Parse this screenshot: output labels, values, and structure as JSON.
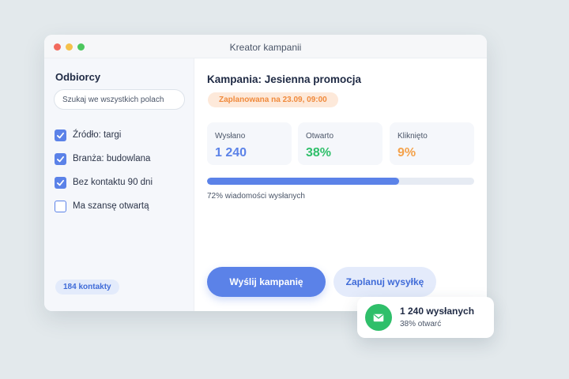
{
  "window": {
    "title": "Kreator kampanii"
  },
  "sidebar": {
    "heading": "Odbiorcy",
    "search_placeholder": "Szukaj we wszystkich polach",
    "filters": [
      {
        "label": "Źródło: targi",
        "checked": true
      },
      {
        "label": "Branża: budowlana",
        "checked": true
      },
      {
        "label": "Bez kontaktu 90 dni",
        "checked": true
      },
      {
        "label": "Ma szansę otwartą",
        "checked": false
      }
    ],
    "count_badge": "184 kontakty"
  },
  "main": {
    "title": "Kampania: Jesienna promocja",
    "scheduled_badge": "Zaplanowana na 23.09, 09:00",
    "stats": [
      {
        "label": "Wysłano",
        "value": "1 240",
        "color": "#5b82e8"
      },
      {
        "label": "Otwarto",
        "value": "38%",
        "color": "#2fbf6a"
      },
      {
        "label": "Kliknięto",
        "value": "9%",
        "color": "#f4a24b"
      }
    ],
    "progress": {
      "percent": 72,
      "label": "72% wiadomości wysłanych"
    },
    "send_button": "Wyślij kampanię",
    "schedule_button": "Zaplanuj wysyłkę"
  },
  "toast": {
    "icon": "mail-icon",
    "title": "1 240 wysłanych",
    "subtitle": "38% otwarć"
  },
  "colors": {
    "accent": "#5b82e8",
    "success": "#2fbf6a",
    "warning": "#f4a24b",
    "background": "#e3e9ec"
  }
}
